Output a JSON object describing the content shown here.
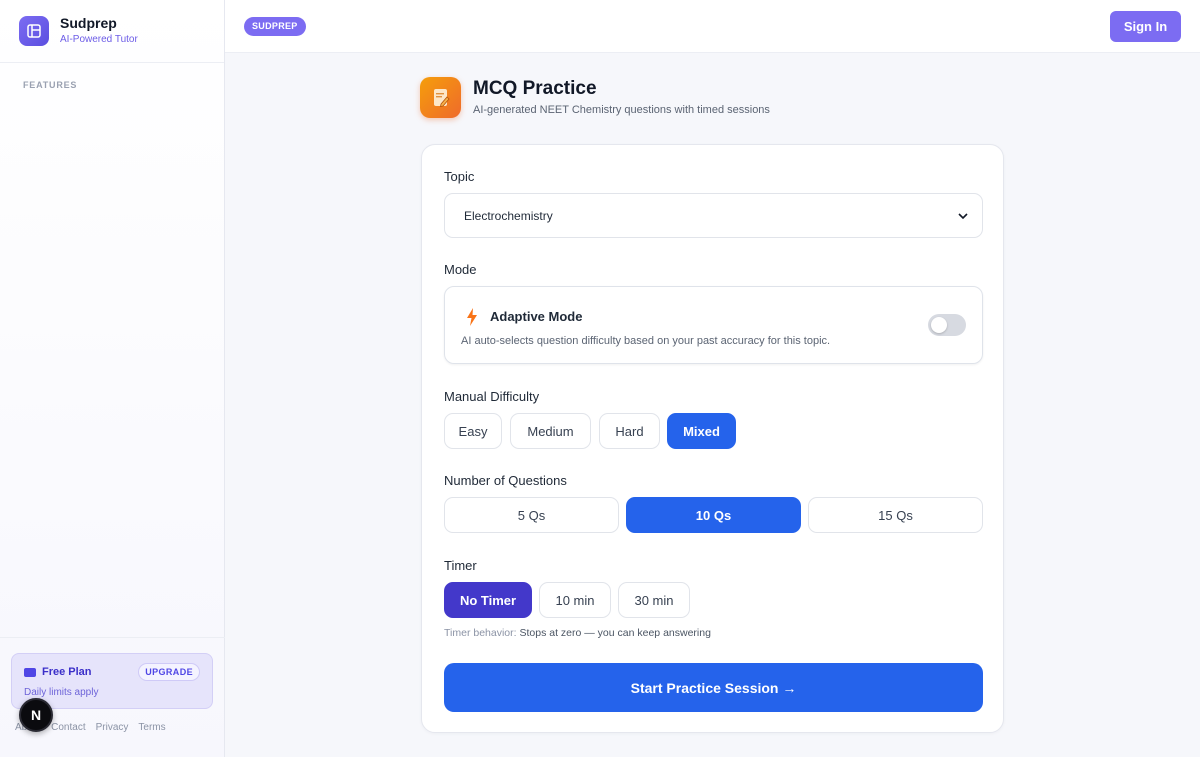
{
  "brand": {
    "name": "Sudprep",
    "tagline": "AI-Powered Tutor"
  },
  "sidebar": {
    "section_label": "FEATURES",
    "plan": {
      "title": "Free Plan",
      "upgrade_label": "UPGRADE",
      "subtitle": "Daily limits apply"
    },
    "footer_links": [
      "About",
      "Contact",
      "Privacy",
      "Terms"
    ],
    "badge_letter": "N"
  },
  "topbar": {
    "badge": "SUDPREP",
    "signin_label": "Sign In"
  },
  "header": {
    "title": "MCQ Practice",
    "subtitle": "AI-generated NEET Chemistry questions with timed sessions"
  },
  "form": {
    "topic": {
      "label": "Topic",
      "value": "Electrochemistry"
    },
    "mode": {
      "label": "Mode",
      "title": "Adaptive Mode",
      "description": "AI auto-selects question difficulty based on your past accuracy for this topic.",
      "enabled": false
    },
    "difficulty": {
      "label": "Manual Difficulty",
      "options": [
        "Easy",
        "Medium",
        "Hard",
        "Mixed"
      ],
      "selected": "Mixed"
    },
    "questions": {
      "label": "Number of Questions",
      "options": [
        "5 Qs",
        "10 Qs",
        "15 Qs"
      ],
      "selected": "10 Qs"
    },
    "timer": {
      "label": "Timer",
      "options": [
        "No Timer",
        "10 min",
        "30 min"
      ],
      "selected": "No Timer",
      "note_prefix": "Timer behavior:",
      "note_value": "Stops at zero — you can keep answering"
    },
    "start_label": "Start Practice Session →"
  },
  "colors": {
    "accent": "#7c6cf2",
    "primary": "#2563eb",
    "indigo": "#4338ca"
  }
}
